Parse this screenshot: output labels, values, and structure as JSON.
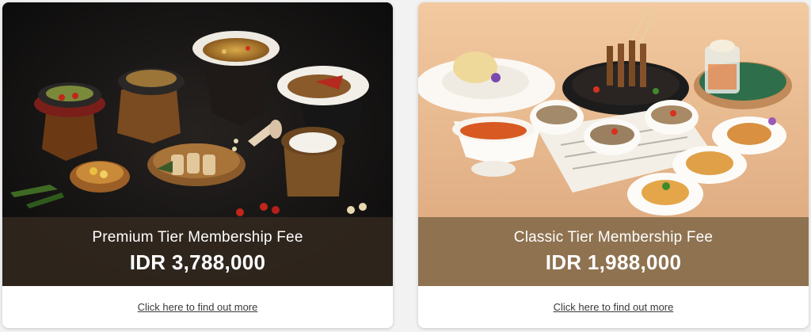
{
  "cards": [
    {
      "image": "thai-feast-dark-background",
      "title": "Premium Tier Membership Fee",
      "price": "IDR 3,788,000",
      "link": "Click here to find out more"
    },
    {
      "image": "thai-feast-peach-background",
      "title": "Classic Tier Membership Fee",
      "price": "IDR 1,988,000",
      "link": "Click here to find out more"
    }
  ],
  "colors": {
    "premium_bg": "#151515",
    "classic_bg": "#e5b58a",
    "overlay_premium": "#342a20",
    "overlay_classic": "#806848",
    "link": "#3a3a3a"
  }
}
